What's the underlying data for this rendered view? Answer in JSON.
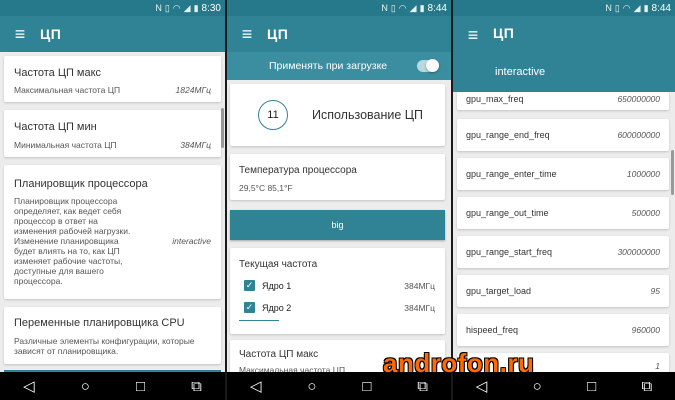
{
  "status": {
    "time_1": "8:30",
    "time_2": "8:44",
    "time_3": "8:44"
  },
  "screen1": {
    "title": "ЦП",
    "cards": [
      {
        "title": "Частота ЦП макс",
        "subtitle": "Максимальная частота ЦП",
        "value": "1824МГц"
      },
      {
        "title": "Частота ЦП мин",
        "subtitle": "Минимальная частота ЦП",
        "value": "384МГц"
      },
      {
        "title": "Планировщик процессора",
        "subtitle_lines": [
          "Планировщик процессора",
          "определяет, как ведет себя",
          "процессор в ответ на",
          "изменения рабочей нагрузки.",
          "Изменение планировщика",
          "будет влиять на то, как ЦП",
          "изменяет рабочие частоты,",
          "доступные для вашего",
          "процессора."
        ],
        "value": "interactive"
      },
      {
        "title": "Переменные планировщика CPU",
        "subtitle_lines": [
          "Различные элементы конфигурации, которые",
          "зависят от планировщика."
        ]
      }
    ]
  },
  "screen2": {
    "title": "ЦП",
    "apply_on_boot": "Применять при загрузке",
    "usage_value": "11",
    "usage_label": "Использование ЦП",
    "temp_title": "Температура процессора",
    "temp_value": "29,5°C 85,1°F",
    "cluster_button": "big",
    "current_freq_title": "Текущая частота",
    "cores": [
      {
        "label": "Ядро 1",
        "value": "384МГц"
      },
      {
        "label": "Ядро 2",
        "value": "384МГц"
      }
    ],
    "max_freq_title": "Частота ЦП макс",
    "max_freq_sub": "Максимальная частота ЦП"
  },
  "screen3": {
    "title": "ЦП",
    "governor": "interactive",
    "rows": [
      {
        "key": "gpu_max_freq",
        "value": "650000000"
      },
      {
        "key": "gpu_range_end_freq",
        "value": "600000000"
      },
      {
        "key": "gpu_range_enter_time",
        "value": "1000000"
      },
      {
        "key": "gpu_range_out_time",
        "value": "500000"
      },
      {
        "key": "gpu_range_start_freq",
        "value": "300000000"
      },
      {
        "key": "gpu_target_load",
        "value": "95"
      },
      {
        "key": "hispeed_freq",
        "value": "960000"
      },
      {
        "key": "",
        "value": "1"
      }
    ]
  },
  "watermark": "androfon.ru",
  "colors": {
    "accent": "#2f8395",
    "statusbar": "#26798a",
    "background": "#ececec",
    "watermark": "#ff6a00"
  },
  "icons": {
    "menu": "hamburger-icon",
    "nav_back": "back-triangle-icon",
    "nav_home": "home-circle-icon",
    "nav_recents": "recents-square-icon",
    "nav_cast": "cast-icon"
  }
}
